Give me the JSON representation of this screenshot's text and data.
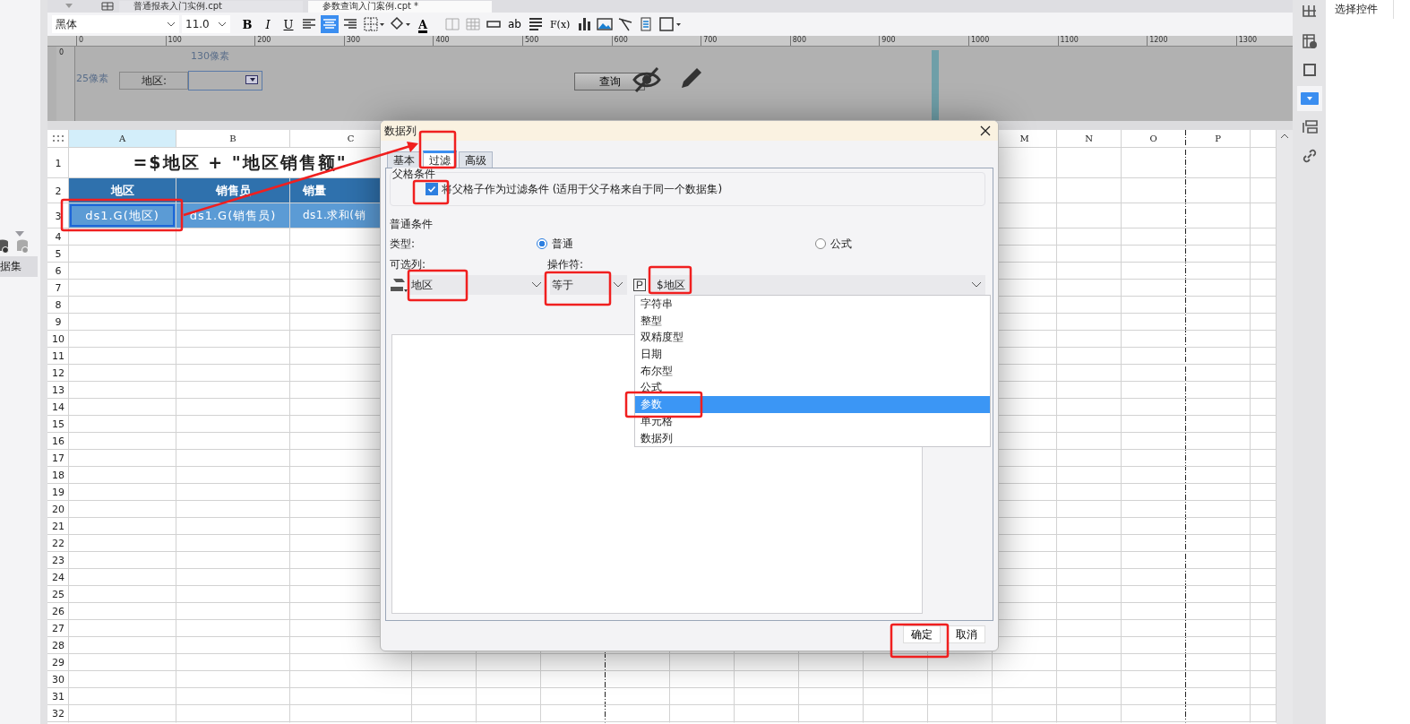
{
  "file_tabs": [
    {
      "label": "普通报表入门实例.cpt",
      "selected": false
    },
    {
      "label": "参数查询入门案例.cpt *",
      "selected": true
    }
  ],
  "toolbar": {
    "font": "黑体",
    "size": "11.0",
    "items": [
      {
        "kind": "bold",
        "label": "B"
      },
      {
        "kind": "italic",
        "label": "I"
      },
      {
        "kind": "underline",
        "label": "U"
      },
      {
        "kind": "align-left",
        "selected": false
      },
      {
        "kind": "align-center",
        "selected": true
      },
      {
        "kind": "align-right",
        "selected": false
      },
      {
        "kind": "border"
      },
      {
        "kind": "fill"
      },
      {
        "kind": "font-color",
        "label": "A"
      },
      {
        "kind": "merge"
      },
      {
        "kind": "grid"
      },
      {
        "kind": "field"
      },
      {
        "kind": "text",
        "label": "ab"
      },
      {
        "kind": "lines"
      },
      {
        "kind": "formula",
        "label": "F(x)"
      },
      {
        "kind": "chart"
      },
      {
        "kind": "image"
      },
      {
        "kind": "slash"
      },
      {
        "kind": "doc"
      },
      {
        "kind": "frame"
      }
    ]
  },
  "sidebar": {
    "section": "据集"
  },
  "ruler": {
    "vertical_ticks": [
      "0"
    ],
    "ticks": [
      "0",
      "100",
      "200",
      "300",
      "400",
      "500",
      "600",
      "700",
      "800",
      "900",
      "1000",
      "1100",
      "1200",
      "1300"
    ]
  },
  "parameter_panel": {
    "width_hint": "130像素",
    "height_hint": "25像素",
    "label": "地区:",
    "query_button": "查询"
  },
  "sheet": {
    "columns": [
      {
        "label": "A",
        "selected": true
      },
      {
        "label": "B",
        "selected": false
      },
      {
        "label": "C",
        "selected": false
      },
      {
        "label": "M",
        "selected": false
      },
      {
        "label": "N",
        "selected": false
      },
      {
        "label": "O",
        "selected": false
      },
      {
        "label": "P",
        "selected": false
      }
    ],
    "rows": [
      {
        "number": "1",
        "cells": [
          {
            "kind": "title",
            "text": "=$地区 + \"地区销售额\""
          }
        ]
      },
      {
        "number": "2",
        "cells": [
          {
            "kind": "header",
            "text": "地区"
          },
          {
            "kind": "header",
            "text": "销售员"
          },
          {
            "kind": "header",
            "text": "销量"
          }
        ]
      },
      {
        "number": "3",
        "cells": [
          {
            "kind": "data",
            "text": "ds1.G(地区)",
            "selected": true
          },
          {
            "kind": "data",
            "text": "ds1.G(销售员)",
            "selected": false
          },
          {
            "kind": "data",
            "text": "ds1.求和(销",
            "selected": false
          }
        ]
      },
      {
        "number": "4"
      },
      {
        "number": "5"
      },
      {
        "number": "6"
      },
      {
        "number": "7"
      },
      {
        "number": "8"
      },
      {
        "number": "9"
      },
      {
        "number": "10"
      },
      {
        "number": "11"
      },
      {
        "number": "12"
      },
      {
        "number": "13"
      },
      {
        "number": "14"
      },
      {
        "number": "15"
      },
      {
        "number": "16"
      },
      {
        "number": "17"
      },
      {
        "number": "18"
      },
      {
        "number": "19"
      },
      {
        "number": "20"
      },
      {
        "number": "21"
      },
      {
        "number": "22"
      },
      {
        "number": "23"
      },
      {
        "number": "24"
      },
      {
        "number": "25"
      },
      {
        "number": "26"
      },
      {
        "number": "27"
      },
      {
        "number": "28"
      },
      {
        "number": "29"
      },
      {
        "number": "30"
      },
      {
        "number": "31"
      },
      {
        "number": "32"
      }
    ]
  },
  "right_panel": {
    "title": "选择控件",
    "tools": [
      {
        "selected": false
      },
      {
        "selected": false
      },
      {
        "selected": false
      },
      {
        "selected": true
      },
      {
        "selected": false
      },
      {
        "selected": false
      }
    ]
  },
  "dialog": {
    "title": "数据列",
    "tabs": [
      {
        "label": "基本",
        "selected": false
      },
      {
        "label": "过滤",
        "selected": true
      },
      {
        "label": "高级",
        "selected": false
      }
    ],
    "parent_group": {
      "title": "父格条件",
      "checkbox": {
        "label": "将父格子作为过滤条件 (适用于父子格来自于同一个数据集)",
        "checked": true
      }
    },
    "normal_group": {
      "title": "普通条件",
      "type_label": "类型:",
      "types": [
        {
          "label": "普通",
          "selected": true
        },
        {
          "label": "公式",
          "selected": false
        }
      ],
      "column_label": "可选列:",
      "column_value": "地区",
      "operator_label": "操作符:",
      "operator_value": "等于",
      "value": "$地区",
      "value_types": [
        {
          "label": "字符串",
          "selected": false
        },
        {
          "label": "整型",
          "selected": false
        },
        {
          "label": "双精度型",
          "selected": false
        },
        {
          "label": "日期",
          "selected": false
        },
        {
          "label": "布尔型",
          "selected": false
        },
        {
          "label": "公式",
          "selected": false
        },
        {
          "label": "参数",
          "selected": true
        },
        {
          "label": "单元格",
          "selected": false
        },
        {
          "label": "数据列",
          "selected": false
        }
      ]
    },
    "buttons": [
      {
        "label": "确定"
      },
      {
        "label": "取消"
      }
    ]
  }
}
